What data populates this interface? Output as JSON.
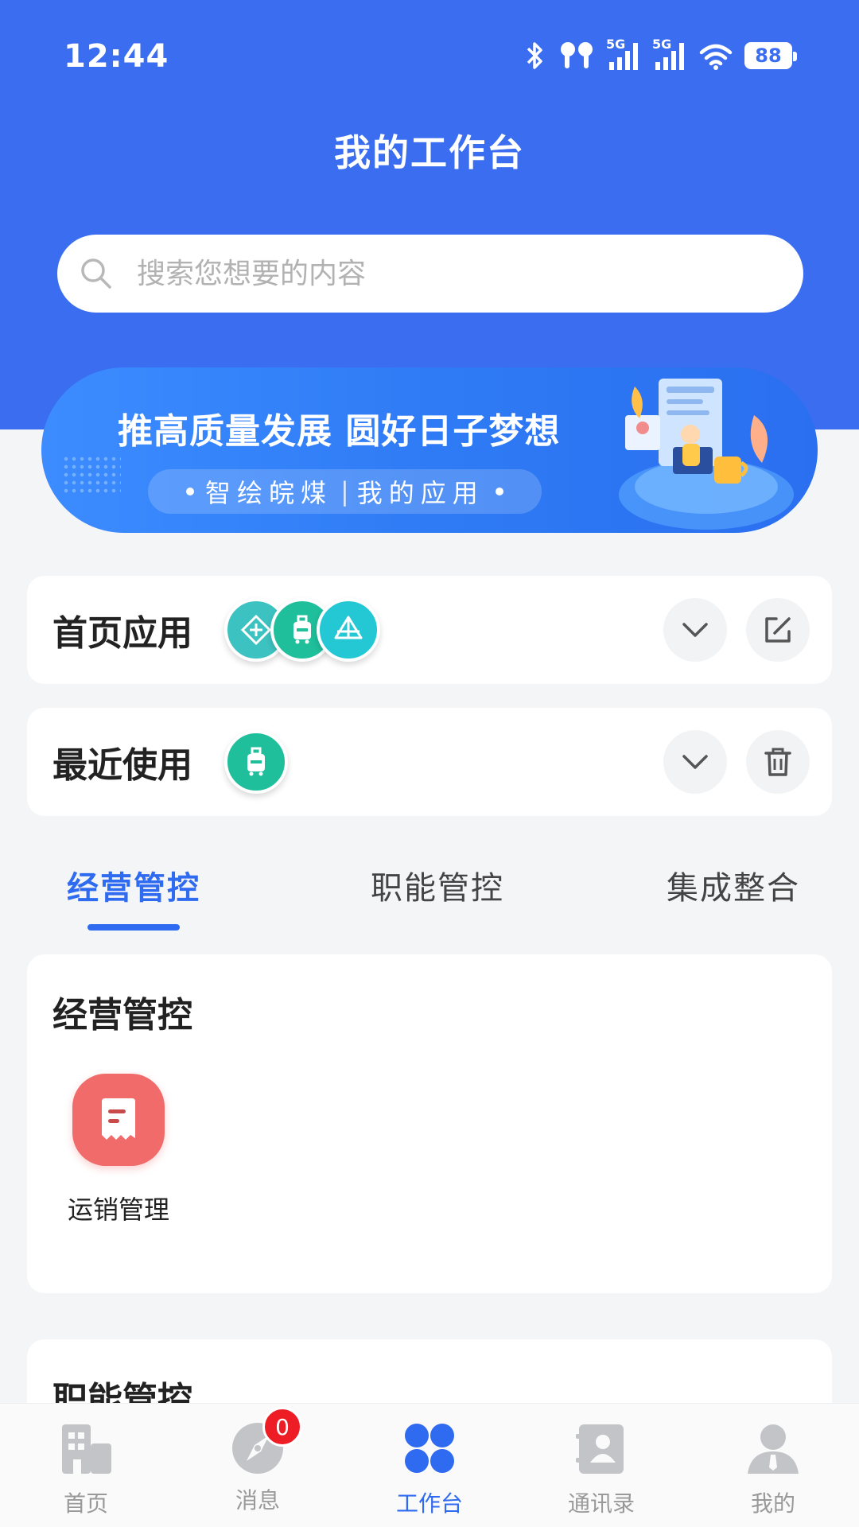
{
  "status_bar": {
    "time": "12:44",
    "network_1": "5G",
    "network_2": "5G",
    "battery": "88",
    "icons": [
      "bluetooth-icon",
      "earbuds-icon",
      "signal-icon",
      "signal-icon",
      "wifi-icon",
      "battery-icon"
    ]
  },
  "header": {
    "title": "我的工作台"
  },
  "search": {
    "placeholder": "搜索您想要的内容",
    "value": ""
  },
  "banner": {
    "headline": "推高质量发展 圆好日子梦想",
    "tag_left": "智绘皖煤",
    "tag_separator": "|",
    "tag_right": "我的应用"
  },
  "home_apps": {
    "title": "首页应用",
    "apps": [
      {
        "icon": "diamond-plus-icon",
        "color": "#3cc2c0"
      },
      {
        "icon": "luggage-icon",
        "color": "#1fbf9c"
      },
      {
        "icon": "pyramid-icon",
        "color": "#23c8d4"
      }
    ],
    "expand_icon": "chevron-down-icon",
    "edit_icon": "edit-icon"
  },
  "recent": {
    "title": "最近使用",
    "apps": [
      {
        "icon": "luggage-icon",
        "color": "#1fbf9c"
      }
    ],
    "expand_icon": "chevron-down-icon",
    "delete_icon": "trash-icon"
  },
  "tabs": [
    {
      "label": "经营管控",
      "active": true
    },
    {
      "label": "职能管控",
      "active": false
    },
    {
      "label": "集成整合",
      "active": false
    }
  ],
  "sections": [
    {
      "title": "经营管控",
      "apps": [
        {
          "label": "运销管理",
          "icon": "receipt-icon",
          "color": "#f26b6b"
        }
      ]
    },
    {
      "title": "职能管控"
    }
  ],
  "bottom_nav": [
    {
      "label": "首页",
      "icon": "building-icon",
      "active": false
    },
    {
      "label": "消息",
      "icon": "compass-icon",
      "active": false,
      "badge": "0"
    },
    {
      "label": "工作台",
      "icon": "grid-icon",
      "active": true
    },
    {
      "label": "通讯录",
      "icon": "contacts-icon",
      "active": false
    },
    {
      "label": "我的",
      "icon": "user-icon",
      "active": false
    }
  ],
  "colors": {
    "primary": "#3a6df0",
    "accent": "#2f6bf0",
    "badge": "#ee1c25",
    "background": "#f4f5f7"
  }
}
